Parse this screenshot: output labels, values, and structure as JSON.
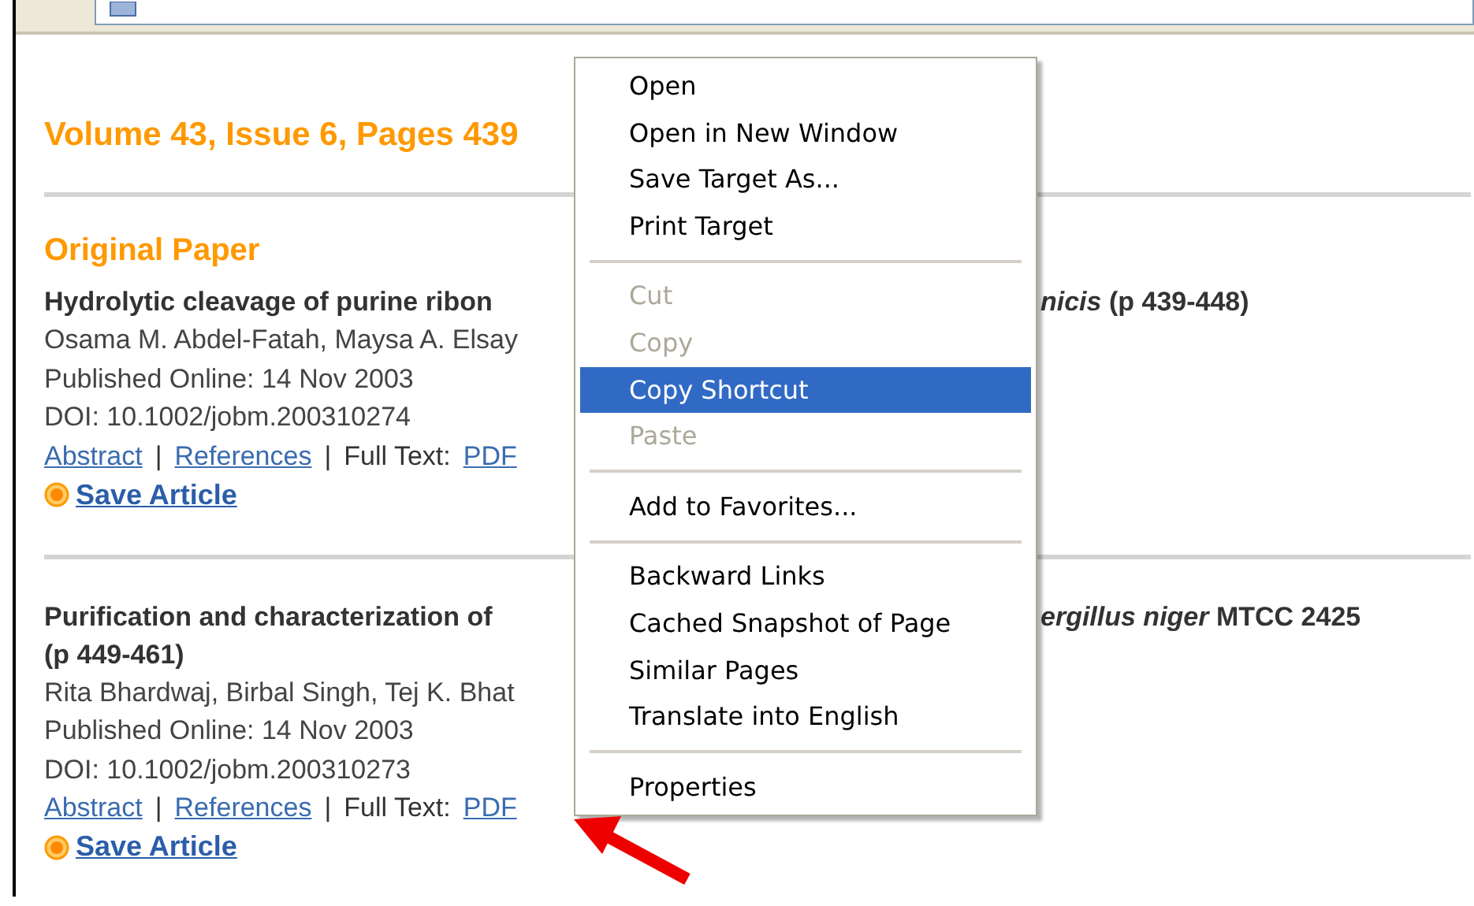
{
  "volume_title": "Volume 43, Issue 6, Pages 439",
  "section_title": "Original Paper",
  "articles": [
    {
      "title_lines": [
        {
          "left": "Hydrolytic cleavage of purine ribon",
          "right": "*nicis* (p 439-448)"
        }
      ],
      "authors": "Osama M. Abdel-Fatah, Maysa A. Elsay",
      "published": "Published Online: 14 Nov 2003",
      "doi": "DOI: 10.1002/jobm.200310274",
      "links": [
        "Abstract",
        "References"
      ],
      "link_separator": "|",
      "full_text_label": "Full Text:",
      "pdf": "PDF",
      "save": "Save Article"
    },
    {
      "title_lines": [
        {
          "left": "Purification and characterization of",
          "right": "*ergillus niger* MTCC 2425"
        },
        {
          "left": "(p 449-461)"
        }
      ],
      "authors": "Rita Bhardwaj, Birbal Singh, Tej K. Bhat",
      "published": "Published Online: 14 Nov 2003",
      "doi": "DOI: 10.1002/jobm.200310273",
      "links": [
        "Abstract",
        "References"
      ],
      "link_separator": "|",
      "full_text_label": "Full Text:",
      "pdf": "PDF",
      "save": "Save Article"
    }
  ],
  "context_menu": [
    {
      "kind": "item",
      "label": "Open",
      "disabled": false,
      "selected": false
    },
    {
      "kind": "item",
      "label": "Open in New Window",
      "disabled": false,
      "selected": false
    },
    {
      "kind": "item",
      "label": "Save Target As...",
      "disabled": false,
      "selected": false
    },
    {
      "kind": "item",
      "label": "Print Target",
      "disabled": false,
      "selected": false
    },
    {
      "kind": "separator"
    },
    {
      "kind": "item",
      "label": "Cut",
      "disabled": true,
      "selected": false
    },
    {
      "kind": "item",
      "label": "Copy",
      "disabled": true,
      "selected": false
    },
    {
      "kind": "item",
      "label": "Copy Shortcut",
      "disabled": false,
      "selected": true
    },
    {
      "kind": "item",
      "label": "Paste",
      "disabled": true,
      "selected": false
    },
    {
      "kind": "separator"
    },
    {
      "kind": "item",
      "label": "Add to Favorites...",
      "disabled": false,
      "selected": false
    },
    {
      "kind": "separator"
    },
    {
      "kind": "item",
      "label": "Backward Links",
      "disabled": false,
      "selected": false
    },
    {
      "kind": "item",
      "label": "Cached Snapshot of Page",
      "disabled": false,
      "selected": false
    },
    {
      "kind": "item",
      "label": "Similar Pages",
      "disabled": false,
      "selected": false
    },
    {
      "kind": "item",
      "label": "Translate into English",
      "disabled": false,
      "selected": false
    },
    {
      "kind": "separator"
    },
    {
      "kind": "item",
      "label": "Properties",
      "disabled": false,
      "selected": false
    }
  ]
}
